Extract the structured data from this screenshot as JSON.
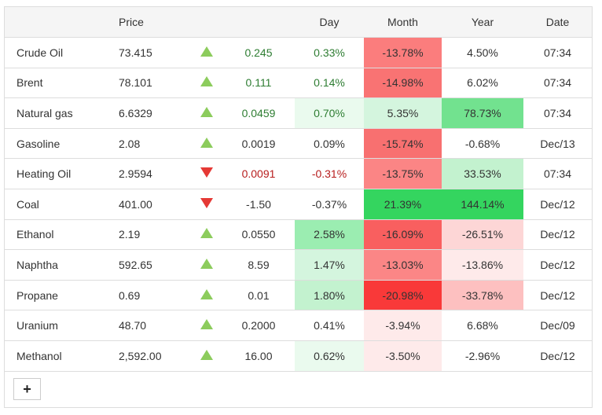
{
  "headers": {
    "name": "",
    "price": "Price",
    "arrow": "",
    "change": "",
    "day": "Day",
    "month": "Month",
    "year": "Year",
    "date": "Date"
  },
  "colors": {
    "up": "#8ccc5c",
    "down": "#e53935",
    "pos_text": "#2e7d32",
    "neg_text": "#b71c1c"
  },
  "rows": [
    {
      "name": "Crude Oil",
      "price": "73.415",
      "dir": "up",
      "change": "0.245",
      "day": "0.33%",
      "month": "-13.78%",
      "year": "4.50%",
      "date": "07:34",
      "tc": "pos",
      "dayBg": "",
      "monthBg": "#fb7d7d",
      "yearBg": ""
    },
    {
      "name": "Brent",
      "price": "78.101",
      "dir": "up",
      "change": "0.111",
      "day": "0.14%",
      "month": "-14.98%",
      "year": "6.02%",
      "date": "07:34",
      "tc": "pos",
      "dayBg": "",
      "monthBg": "#f97373",
      "yearBg": ""
    },
    {
      "name": "Natural gas",
      "price": "6.6329",
      "dir": "up",
      "change": "0.0459",
      "day": "0.70%",
      "month": "5.35%",
      "year": "78.73%",
      "date": "07:34",
      "tc": "pos",
      "dayBg": "#eafaee",
      "monthBg": "#d4f5de",
      "yearBg": "#72e28f"
    },
    {
      "name": "Gasoline",
      "price": "2.08",
      "dir": "up",
      "change": "0.0019",
      "day": "0.09%",
      "month": "-15.74%",
      "year": "-0.68%",
      "date": "Dec/13",
      "tc": "",
      "dayBg": "",
      "monthBg": "#f87070",
      "yearBg": ""
    },
    {
      "name": "Heating Oil",
      "price": "2.9594",
      "dir": "down",
      "change": "0.0091",
      "day": "-0.31%",
      "month": "-13.75%",
      "year": "33.53%",
      "date": "07:34",
      "tc": "neg",
      "dayBg": "",
      "monthBg": "#fb8585",
      "yearBg": "#c3f2cf"
    },
    {
      "name": "Coal",
      "price": "401.00",
      "dir": "down",
      "change": "-1.50",
      "day": "-0.37%",
      "month": "21.39%",
      "year": "144.14%",
      "date": "Dec/12",
      "tc": "",
      "dayBg": "",
      "monthBg": "#34d55f",
      "yearBg": "#34d55f"
    },
    {
      "name": "Ethanol",
      "price": "2.19",
      "dir": "up",
      "change": "0.0550",
      "day": "2.58%",
      "month": "-16.09%",
      "year": "-26.51%",
      "date": "Dec/12",
      "tc": "",
      "dayBg": "#9bedb1",
      "monthBg": "#f95f5f",
      "yearBg": "#fdd6d6"
    },
    {
      "name": "Naphtha",
      "price": "592.65",
      "dir": "up",
      "change": "8.59",
      "day": "1.47%",
      "month": "-13.03%",
      "year": "-13.86%",
      "date": "Dec/12",
      "tc": "",
      "dayBg": "#d4f5de",
      "monthBg": "#fb8686",
      "yearBg": "#feeaea"
    },
    {
      "name": "Propane",
      "price": "0.69",
      "dir": "up",
      "change": "0.01",
      "day": "1.80%",
      "month": "-20.98%",
      "year": "-33.78%",
      "date": "Dec/12",
      "tc": "",
      "dayBg": "#c3f2cf",
      "monthBg": "#f93939",
      "yearBg": "#fdc0c0"
    },
    {
      "name": "Uranium",
      "price": "48.70",
      "dir": "up",
      "change": "0.2000",
      "day": "0.41%",
      "month": "-3.94%",
      "year": "6.68%",
      "date": "Dec/09",
      "tc": "",
      "dayBg": "",
      "monthBg": "#feeaea",
      "yearBg": ""
    },
    {
      "name": "Methanol",
      "price": "2,592.00",
      "dir": "up",
      "change": "16.00",
      "day": "0.62%",
      "month": "-3.50%",
      "year": "-2.96%",
      "date": "Dec/12",
      "tc": "",
      "dayBg": "#eafaee",
      "monthBg": "#feeaea",
      "yearBg": ""
    }
  ],
  "add_button": {
    "label": "+",
    "icon": "plus-icon"
  }
}
